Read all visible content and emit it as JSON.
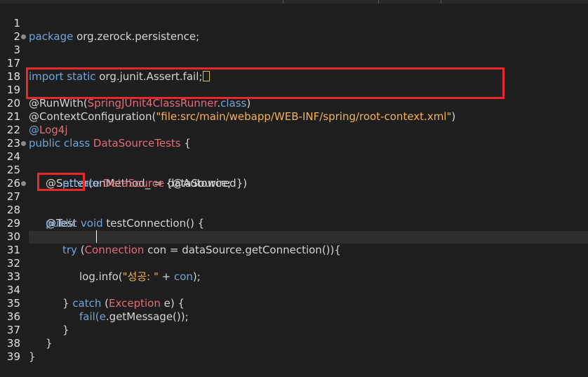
{
  "lines": [
    {
      "num": "1"
    },
    {
      "num": "2"
    },
    {
      "num": "3"
    },
    {
      "num": "17"
    },
    {
      "num": "18"
    },
    {
      "num": "19"
    },
    {
      "num": "20"
    },
    {
      "num": "21"
    },
    {
      "num": "22"
    },
    {
      "num": "23"
    },
    {
      "num": "24"
    },
    {
      "num": "25"
    },
    {
      "num": "26"
    },
    {
      "num": "27"
    },
    {
      "num": "28"
    },
    {
      "num": "29"
    },
    {
      "num": "30"
    },
    {
      "num": "31"
    },
    {
      "num": "32"
    },
    {
      "num": "33"
    },
    {
      "num": "34"
    },
    {
      "num": "35"
    },
    {
      "num": "36"
    },
    {
      "num": "37"
    },
    {
      "num": "38"
    },
    {
      "num": "39"
    }
  ],
  "code": {
    "l1_kw": "package",
    "l1_rest": " org.zerock.persistence;",
    "l3_kw1": "import",
    "l3_kw2": " static",
    "l3_rest": " org.junit.Assert.fail;",
    "l19_ann": "@RunWith(",
    "l19_type": "SpringJUnit4ClassRunner",
    "l19_dot": ".",
    "l19_kw": "class",
    "l19_close": ")",
    "l20_ann": "@ContextConfiguration(",
    "l20_str": "\"file:src/main/webapp/WEB-INF/spring/root-context.xml\"",
    "l20_close": ")",
    "l21_at": "@",
    "l21_type": "Log4j",
    "l22_kw": "public class",
    "l22_type": " DataSourceTests",
    "l22_rest": " {",
    "l24_ann": "@Setter(onMethod_ = {@Autowired})",
    "l25_kw": "private",
    "l25_type": " DataSource",
    "l25_rest": " dataSource;",
    "l27_ann": "@Test",
    "l28_kw": "public void",
    "l28_rest": " testConnection() {",
    "l30_kw": "try",
    "l30_open": " (",
    "l30_type": "Connection",
    "l30_rest": " con = dataSource.getConnection()){",
    "l32_var": "log",
    "l32_mid": ".info(",
    "l32_str": "\"성공: \"",
    "l32_plus": " + ",
    "l32_con": "con",
    "l32_end": ");",
    "l34_close": "} ",
    "l34_kw": "catch",
    "l34_open": " (",
    "l34_type": "Exception",
    "l34_rest": " e) {",
    "l35_fn": "fail(",
    "l35_e": "e",
    "l35_rest": ".getMessage());",
    "l36": "}",
    "l37": "}",
    "l38": "}"
  },
  "colors": {
    "background": "#1e1e1e",
    "keyword": "#6fa5d8",
    "type": "#e06c75",
    "string": "#f5b15a",
    "highlight_box": "#e8262c"
  }
}
